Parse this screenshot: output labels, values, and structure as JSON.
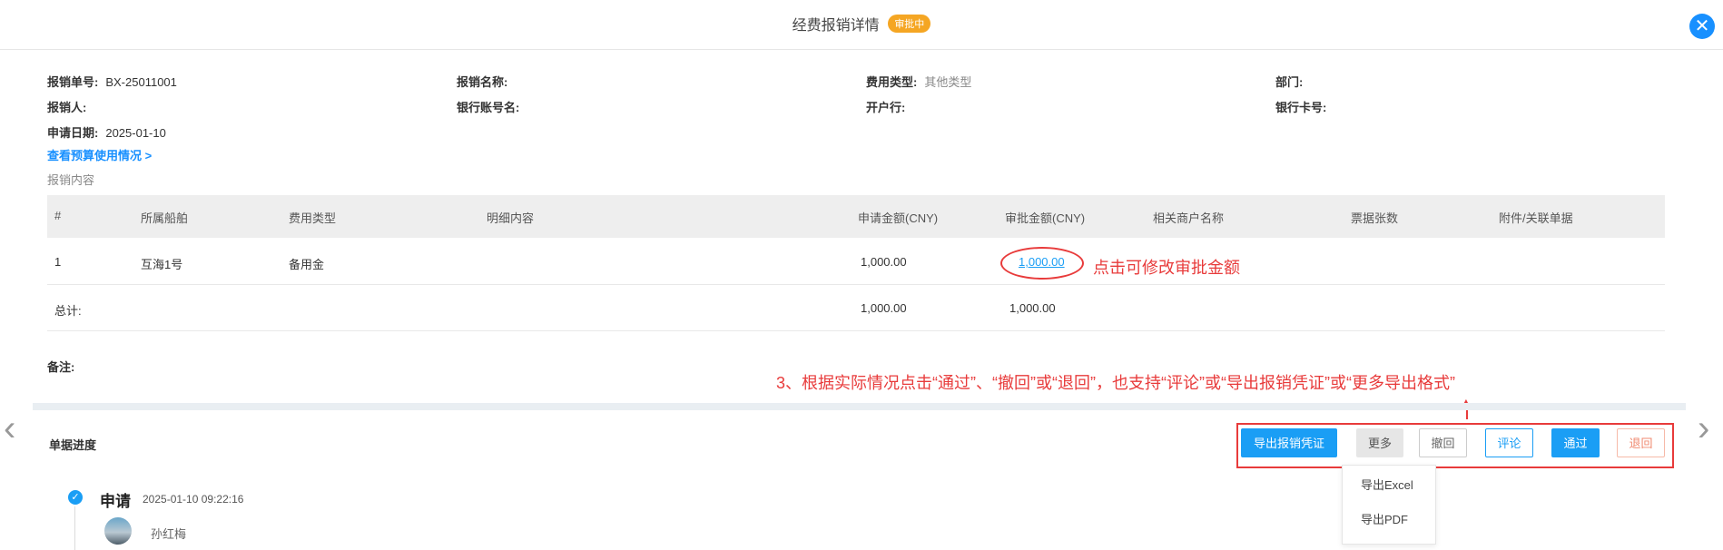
{
  "header": {
    "title": "经费报销详情",
    "status_badge": "审批中",
    "close_icon": "close-icon",
    "close_glyph": "✕"
  },
  "info": {
    "doc_no_label": "报销单号:",
    "doc_no_value": "BX-25011001",
    "name_label": "报销名称:",
    "fee_type_label": "费用类型:",
    "fee_type_value": "其他类型",
    "dept_label": "部门:",
    "reimburser_label": "报销人:",
    "bank_name_label": "银行账号名:",
    "bank_label": "开户行:",
    "card_label": "银行卡号:",
    "date_label": "申请日期:",
    "date_value": "2025-01-10",
    "budget_link": "查看预算使用情况 >",
    "content_label": "报销内容"
  },
  "table": {
    "headers": [
      "#",
      "所属船舶",
      "费用类型",
      "明细内容",
      "申请金额(CNY)",
      "审批金额(CNY)",
      "相关商户名称",
      "票据张数",
      "附件/关联单据"
    ],
    "rows": [
      {
        "index": "1",
        "ship": "互海1号",
        "fee_type": "备用金",
        "detail": "",
        "apply_amount": "1,000.00",
        "approve_amount": "1,000.00"
      }
    ],
    "total_label": "总计:",
    "total_apply": "1,000.00",
    "total_approve": "1,000.00"
  },
  "remark_label": "备注:",
  "annotations": {
    "edit_hint": "点击可修改审批金额",
    "actions_hint": "3、根据实际情况点击“通过”、“撤回”或“退回”，也支持“评论”或“导出报销凭证”或“更多导出格式”",
    "arrow_glyph": "▲"
  },
  "progress": {
    "title": "单据进度",
    "step_name": "申请",
    "step_time": "2025-01-10 09:22:16",
    "user_name": "孙红梅",
    "check_glyph": "✓"
  },
  "actions": {
    "export_voucher": "导出报销凭证",
    "more": "更多",
    "withdraw": "撤回",
    "comment": "评论",
    "approve": "通过",
    "reject": "退回"
  },
  "more_menu": [
    "导出Excel",
    "导出PDF"
  ],
  "nav": {
    "prev_glyph": "‹",
    "next_glyph": "›"
  },
  "colors": {
    "primary": "#1a9ef5",
    "badge": "#f5a623",
    "annotation": "#e83b3b"
  }
}
